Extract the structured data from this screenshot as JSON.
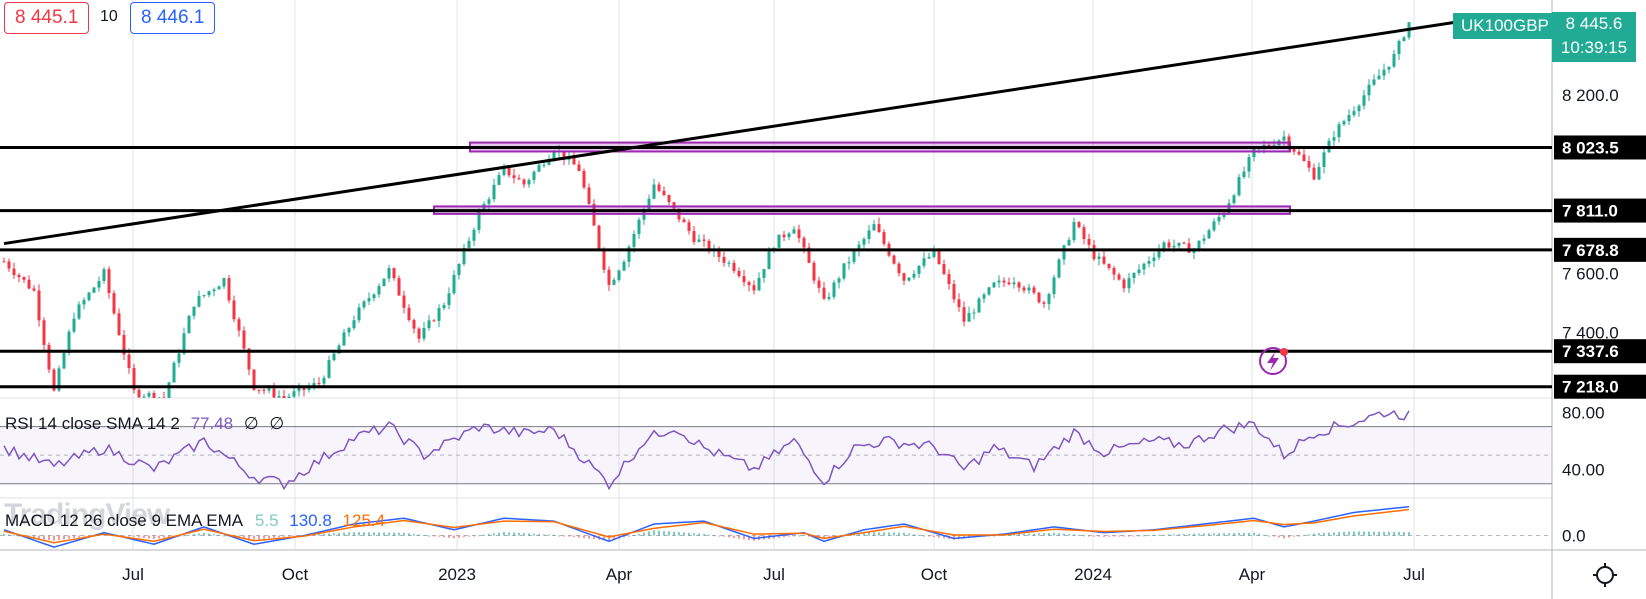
{
  "header": {
    "bid": "8 445.1",
    "spread": "10",
    "ask": "8 446.1",
    "symbol": "UK100GBP",
    "last_price": "8 445.6",
    "countdown": "10:39:15"
  },
  "indicators": {
    "rsi_label": "RSI 14 close SMA 14 2",
    "rsi_value": "77.48",
    "rsi_extra1": "∅",
    "rsi_extra2": "∅",
    "macd_label": "MACD 12 26 close 9 EMA EMA",
    "macd_hist": "5.5",
    "macd_line": "130.8",
    "macd_signal": "125.4"
  },
  "watermark": "TradingView",
  "colors": {
    "up": "#22ab94",
    "down": "#f23645",
    "levels": "#000000",
    "zones": "#9c27b0",
    "rsi": "#7e57c2",
    "macd": "#2962ff",
    "signal": "#ff6d00",
    "hist_up": "#26a69a",
    "hist_down": "#ef5350"
  },
  "chart_data": {
    "type": "candlestick",
    "ylim": [
      7180,
      8520
    ],
    "x_ticks": [
      "Jul",
      "Oct",
      "2023",
      "Apr",
      "Jul",
      "Oct",
      "2024",
      "Apr",
      "Jul"
    ],
    "y_ticks": [
      "8 200.0",
      "7 600.0",
      "7 400.0"
    ],
    "price_path": [
      [
        0,
        7640
      ],
      [
        6,
        7540
      ],
      [
        10,
        7200
      ],
      [
        14,
        7460
      ],
      [
        20,
        7600
      ],
      [
        26,
        7200
      ],
      [
        32,
        7180
      ],
      [
        38,
        7500
      ],
      [
        44,
        7580
      ],
      [
        50,
        7220
      ],
      [
        56,
        7180
      ],
      [
        63,
        7230
      ],
      [
        70,
        7450
      ],
      [
        77,
        7610
      ],
      [
        83,
        7380
      ],
      [
        88,
        7500
      ],
      [
        95,
        7800
      ],
      [
        100,
        7950
      ],
      [
        104,
        7900
      ],
      [
        110,
        8020
      ],
      [
        115,
        7950
      ],
      [
        121,
        7560
      ],
      [
        124,
        7650
      ],
      [
        130,
        7900
      ],
      [
        138,
        7720
      ],
      [
        146,
        7620
      ],
      [
        150,
        7550
      ],
      [
        154,
        7700
      ],
      [
        158,
        7760
      ],
      [
        164,
        7500
      ],
      [
        168,
        7620
      ],
      [
        174,
        7760
      ],
      [
        180,
        7580
      ],
      [
        186,
        7670
      ],
      [
        192,
        7440
      ],
      [
        198,
        7560
      ],
      [
        202,
        7580
      ],
      [
        208,
        7500
      ],
      [
        214,
        7770
      ],
      [
        218,
        7660
      ],
      [
        224,
        7560
      ],
      [
        232,
        7700
      ],
      [
        238,
        7680
      ],
      [
        244,
        7810
      ],
      [
        250,
        8010
      ],
      [
        256,
        8060
      ],
      [
        262,
        7930
      ],
      [
        266,
        8070
      ],
      [
        272,
        8200
      ],
      [
        278,
        8330
      ],
      [
        281,
        8445
      ]
    ],
    "levels": [
      "8 023.5",
      "7 811.0",
      "7 678.8",
      "7 337.6",
      "7 218.0"
    ],
    "zones": [
      [
        8010,
        8040
      ],
      [
        7800,
        7825
      ]
    ],
    "trendline": [
      [
        0,
        7700
      ],
      [
        300,
        8470
      ]
    ],
    "rsi": {
      "ylim": [
        20,
        90
      ],
      "y_ticks": [
        "80.00",
        "40.00"
      ],
      "bands": [
        70,
        30
      ],
      "path": [
        [
          0,
          55
        ],
        [
          10,
          42
        ],
        [
          20,
          55
        ],
        [
          30,
          40
        ],
        [
          40,
          60
        ],
        [
          50,
          35
        ],
        [
          56,
          30
        ],
        [
          70,
          62
        ],
        [
          77,
          70
        ],
        [
          84,
          50
        ],
        [
          95,
          70
        ],
        [
          104,
          65
        ],
        [
          110,
          68
        ],
        [
          121,
          30
        ],
        [
          128,
          60
        ],
        [
          134,
          70
        ],
        [
          140,
          55
        ],
        [
          150,
          40
        ],
        [
          158,
          60
        ],
        [
          164,
          32
        ],
        [
          170,
          55
        ],
        [
          176,
          60
        ],
        [
          186,
          56
        ],
        [
          192,
          40
        ],
        [
          198,
          55
        ],
        [
          206,
          42
        ],
        [
          214,
          66
        ],
        [
          220,
          52
        ],
        [
          230,
          60
        ],
        [
          236,
          57
        ],
        [
          244,
          68
        ],
        [
          250,
          72
        ],
        [
          256,
          50
        ],
        [
          262,
          66
        ],
        [
          270,
          73
        ],
        [
          276,
          80
        ],
        [
          281,
          78
        ]
      ]
    },
    "macd": {
      "ylim": [
        -50,
        130
      ],
      "y_ticks": [
        "0.0"
      ],
      "zero": 0,
      "macd_path": [
        [
          0,
          20
        ],
        [
          10,
          -40
        ],
        [
          20,
          10
        ],
        [
          30,
          -30
        ],
        [
          40,
          30
        ],
        [
          50,
          -30
        ],
        [
          60,
          0
        ],
        [
          70,
          40
        ],
        [
          80,
          60
        ],
        [
          90,
          20
        ],
        [
          100,
          60
        ],
        [
          110,
          50
        ],
        [
          121,
          -20
        ],
        [
          130,
          40
        ],
        [
          140,
          50
        ],
        [
          150,
          -10
        ],
        [
          160,
          10
        ],
        [
          164,
          -20
        ],
        [
          172,
          20
        ],
        [
          180,
          40
        ],
        [
          190,
          -10
        ],
        [
          200,
          5
        ],
        [
          210,
          30
        ],
        [
          220,
          10
        ],
        [
          230,
          20
        ],
        [
          240,
          40
        ],
        [
          250,
          60
        ],
        [
          256,
          30
        ],
        [
          262,
          50
        ],
        [
          270,
          80
        ],
        [
          281,
          100
        ]
      ],
      "signal_path": [
        [
          0,
          15
        ],
        [
          10,
          -25
        ],
        [
          20,
          5
        ],
        [
          30,
          -20
        ],
        [
          40,
          22
        ],
        [
          50,
          -18
        ],
        [
          60,
          -2
        ],
        [
          70,
          30
        ],
        [
          80,
          52
        ],
        [
          90,
          28
        ],
        [
          100,
          50
        ],
        [
          110,
          48
        ],
        [
          121,
          -5
        ],
        [
          130,
          25
        ],
        [
          140,
          45
        ],
        [
          150,
          5
        ],
        [
          160,
          8
        ],
        [
          164,
          -10
        ],
        [
          172,
          10
        ],
        [
          180,
          32
        ],
        [
          190,
          2
        ],
        [
          200,
          2
        ],
        [
          210,
          22
        ],
        [
          220,
          14
        ],
        [
          230,
          18
        ],
        [
          240,
          34
        ],
        [
          250,
          52
        ],
        [
          256,
          38
        ],
        [
          262,
          44
        ],
        [
          270,
          68
        ],
        [
          281,
          90
        ]
      ]
    }
  }
}
